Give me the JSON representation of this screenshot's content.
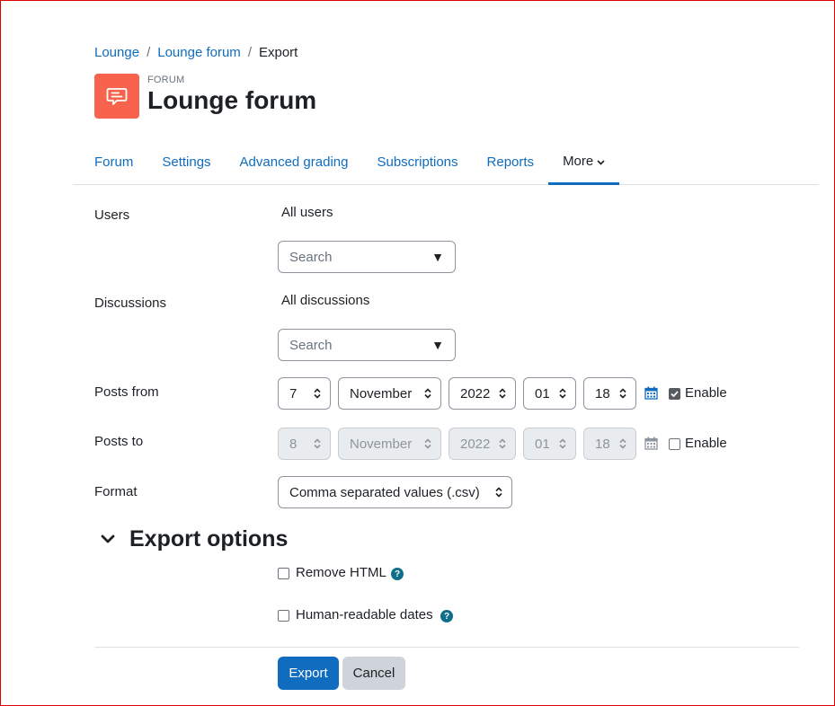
{
  "breadcrumb": {
    "items": [
      "Lounge",
      "Lounge forum"
    ],
    "separator": "/",
    "current": "Export"
  },
  "header": {
    "type": "FORUM",
    "title": "Lounge forum",
    "icon": "forum-speech-bubble-icon",
    "icon_bg": "#f7634d"
  },
  "tabs": [
    "Forum",
    "Settings",
    "Advanced grading",
    "Subscriptions",
    "Reports",
    "More"
  ],
  "active_tab": "More",
  "form": {
    "users": {
      "label": "Users",
      "value": "All users",
      "search_placeholder": "Search"
    },
    "discussions": {
      "label": "Discussions",
      "value": "All discussions",
      "search_placeholder": "Search"
    },
    "posts_from": {
      "label": "Posts from",
      "day": "7",
      "month": "November",
      "year": "2022",
      "hour": "01",
      "minute": "18",
      "enable_label": "Enable",
      "enabled": true
    },
    "posts_to": {
      "label": "Posts to",
      "day": "8",
      "month": "November",
      "year": "2022",
      "hour": "01",
      "minute": "18",
      "enable_label": "Enable",
      "enabled": false
    },
    "format": {
      "label": "Format",
      "value": "Comma separated values (.csv)"
    }
  },
  "export_options": {
    "title": "Export options",
    "remove_html": {
      "label": "Remove HTML",
      "checked": false
    },
    "human_dates": {
      "label": "Human-readable dates",
      "checked": false
    }
  },
  "buttons": {
    "export": "Export",
    "cancel": "Cancel"
  },
  "colors": {
    "link": "#0f6cbf",
    "primary": "#0f6cbf",
    "help": "#0f6f8a"
  }
}
